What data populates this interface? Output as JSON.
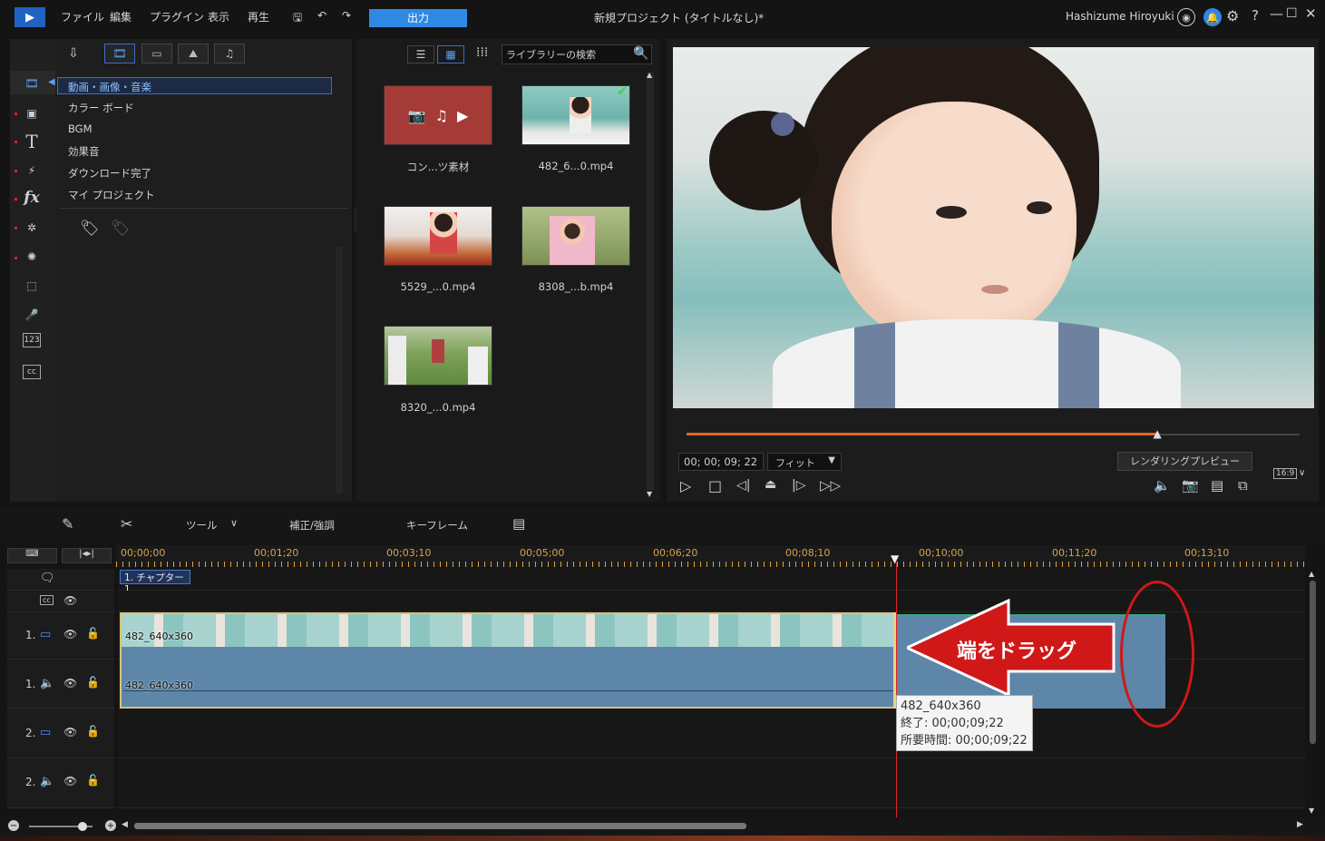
{
  "menu": {
    "file": "ファイル",
    "edit": "編集",
    "plugins": "プラグイン",
    "view": "表示",
    "playback": "再生",
    "output": "出力"
  },
  "title": "新規プロジェクト (タイトルなし)*",
  "user": "Hashizume Hiroyuki",
  "library": {
    "tree": [
      "動画・画像・音楽",
      "カラー ボード",
      "BGM",
      "効果音",
      "ダウンロード完了",
      "マイ プロジェクト"
    ],
    "search_placeholder": "ライブラリーの検索",
    "items": [
      {
        "name": "コン...ツ素材"
      },
      {
        "name": "482_6...0.mp4"
      },
      {
        "name": "5529_...0.mp4"
      },
      {
        "name": "8308_...b.mp4"
      },
      {
        "name": "8320_...0.mp4"
      }
    ]
  },
  "preview": {
    "timecode": "00; 00; 09; 22",
    "fit": "フィット",
    "render_preview": "レンダリングプレビュー",
    "aspect": "16:9",
    "progress": 0.77
  },
  "timeline": {
    "tools": {
      "tools_label": "ツール",
      "adjust": "補正/強調",
      "keyframe": "キーフレーム"
    },
    "ruler": [
      "00;00;00",
      "00;01;20",
      "00;03;10",
      "00;05;00",
      "00;06;20",
      "00;08;10",
      "00;10;00",
      "00;11;20",
      "00;13;10"
    ],
    "chapter": "1. チャプター 1",
    "clip_label": "482_640x360",
    "tracks": [
      "1.",
      "1.",
      "2.",
      "2."
    ],
    "callout": "端をドラッグ",
    "tooltip": {
      "name": "482_640x360",
      "end": "終了: 00;00;09;22",
      "duration": "所要時間: 00;00;09;22"
    }
  },
  "colors": {
    "accent": "#2f88e4",
    "callout_red": "#d01818",
    "progress": "#e6661e"
  }
}
